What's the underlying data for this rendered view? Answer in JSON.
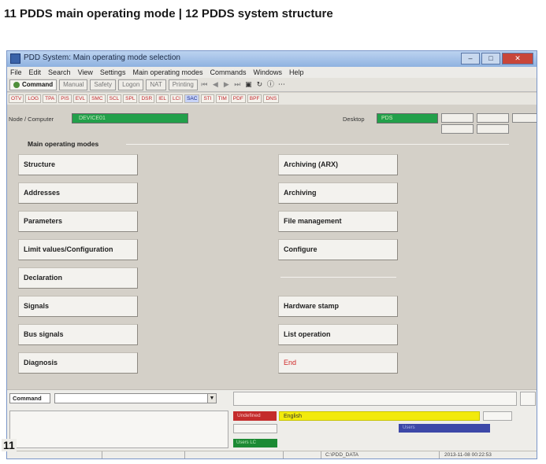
{
  "caption": "11 PDDS main operating mode  |  12 PDDS system structure",
  "figure_number": "11",
  "window": {
    "title": "PDD System: Main operating mode selection",
    "menu": [
      "File",
      "Edit",
      "Search",
      "View",
      "Settings",
      "Main operating modes",
      "Commands",
      "Windows",
      "Help"
    ]
  },
  "toolbar": {
    "buttons": [
      "Command",
      "Manual",
      "Safety",
      "Logon",
      "NAT",
      "Printing"
    ]
  },
  "tabs": [
    "OTV",
    "LOG",
    "TPA",
    "PIS",
    "EVL",
    "SMC",
    "SCL",
    "SPL",
    "DSR",
    "IEL",
    "LCI",
    "SAC",
    "STI",
    "TIM",
    "PDF",
    "BPF",
    "DNS"
  ],
  "node": {
    "label": "Node / Computer",
    "value": "DEVICE01",
    "desktop_label": "Desktop",
    "desktop_value": "PDS"
  },
  "main": {
    "group_title": "Main operating modes",
    "left_buttons": [
      "Structure",
      "Addresses",
      "Parameters",
      "Limit values/Configuration",
      "Declaration",
      "Signals",
      "Bus signals",
      "Diagnosis"
    ],
    "right_buttons_top": [
      "Archiving (ARX)",
      "Archiving",
      "File management",
      "Configure"
    ],
    "right_buttons_bottom": [
      "Hardware stamp",
      "List operation"
    ],
    "exit_label": "End"
  },
  "bottom": {
    "command_label": "Command",
    "status_red": "Undefined",
    "language": "English",
    "blue_value": "Users",
    "green_value": "Users LC",
    "path": "C:\\PDD_DATA",
    "timestamp": "2013-11-08 00:22:53"
  },
  "colors": {
    "node_green": "#22a04a",
    "language_yellow": "#f2ea0c",
    "status_red": "#c42b2b",
    "field_blue": "#3d48a8",
    "exit_red": "#d02a2a"
  }
}
